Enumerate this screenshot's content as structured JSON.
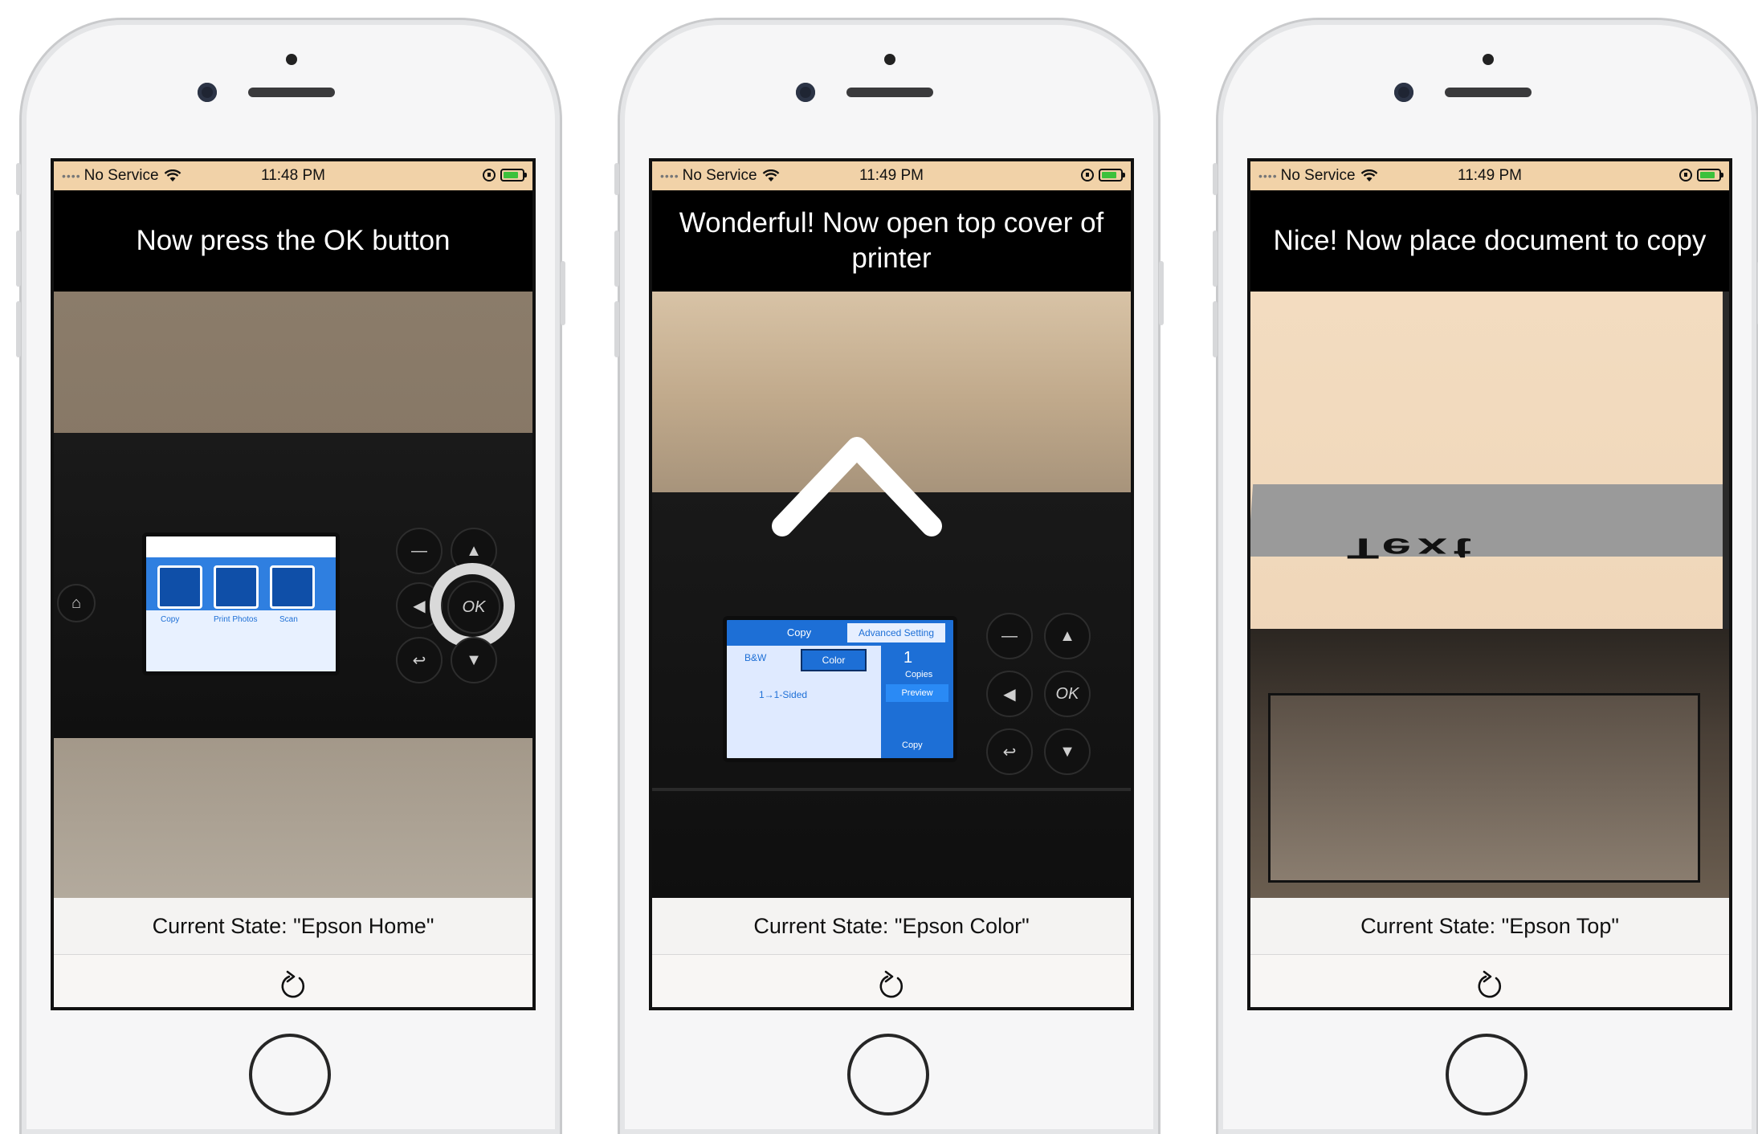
{
  "phones": [
    {
      "status": {
        "carrier": "No Service",
        "time": "11:48 PM"
      },
      "instruction": "Now press the OK button",
      "state_label": "Current State: \"Epson Home\"",
      "scene": {
        "lcd_labels": [
          "Copy",
          "Print Photos",
          "Scan"
        ],
        "ok_label": "OK"
      }
    },
    {
      "status": {
        "carrier": "No Service",
        "time": "11:49 PM"
      },
      "instruction": "Wonderful! Now open top cover of printer",
      "state_label": "Current State: \"Epson Color\"",
      "scene": {
        "lcd_tabs": [
          "Copy",
          "Advanced Setting"
        ],
        "lcd_bw": "B&W",
        "lcd_color": "Color",
        "lcd_copies_value": "1",
        "lcd_copies_label": "Copies",
        "lcd_sided": "1→1-Sided",
        "lcd_preview": "Preview",
        "lcd_copy_btn": "Copy",
        "ok_label": "OK"
      }
    },
    {
      "status": {
        "carrier": "No Service",
        "time": "11:49 PM"
      },
      "instruction": "Nice! Now place document to copy",
      "state_label": "Current State: \"Epson Top\"",
      "scene": {
        "ar_text": "Text"
      }
    }
  ],
  "icons": {
    "refresh": "refresh-icon",
    "wifi": "wifi-icon",
    "battery": "battery-charging-icon",
    "rotation_lock": "rotation-lock-icon"
  },
  "colors": {
    "status_bar": "#f1d2a8",
    "banner": "#000000",
    "lcd_blue": "#1d6fd6"
  }
}
